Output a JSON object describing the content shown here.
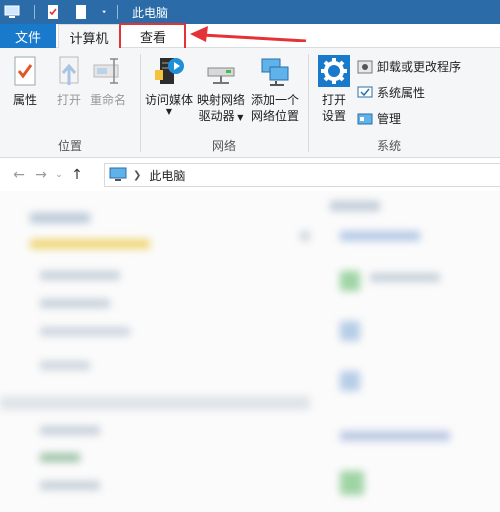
{
  "window": {
    "title": "此电脑"
  },
  "tabs": {
    "file": "文件",
    "computer": "计算机",
    "view": "查看"
  },
  "ribbon": {
    "location": {
      "label": "位置",
      "properties": "属性",
      "open": "打开",
      "rename": "重命名"
    },
    "network": {
      "label": "网络",
      "access_media": "访问媒体",
      "map_drive_line1": "映射网络",
      "map_drive_line2": "驱动器",
      "add_location_line1": "添加一个",
      "add_location_line2": "网络位置"
    },
    "system": {
      "label": "系统",
      "open_settings_line1": "打开",
      "open_settings_line2": "设置",
      "uninstall": "卸载或更改程序",
      "system_properties": "系统属性",
      "manage": "管理"
    }
  },
  "address": {
    "path": "此电脑"
  },
  "colors": {
    "titlebar": "#2b6ca8",
    "file_tab": "#1979ca",
    "highlight": "#e53237"
  }
}
